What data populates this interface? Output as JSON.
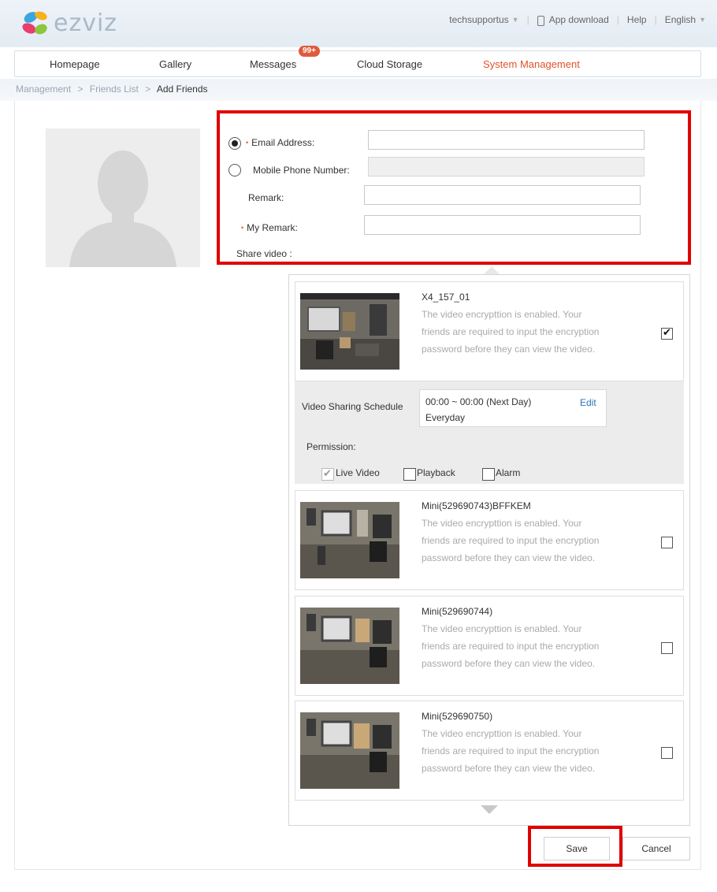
{
  "brand": {
    "name": "ezviz"
  },
  "top_links": {
    "user": "techsupportus",
    "app_download": "App download",
    "help": "Help",
    "language": "English"
  },
  "nav": {
    "items": [
      {
        "label": "Homepage"
      },
      {
        "label": "Gallery"
      },
      {
        "label": "Messages",
        "badge": "99+"
      },
      {
        "label": "Cloud Storage"
      },
      {
        "label": "System Management",
        "active": true
      }
    ]
  },
  "breadcrumb": {
    "items": [
      "Management",
      "Friends List",
      "Add Friends"
    ],
    "separator": ">"
  },
  "form": {
    "email_label": "Email Address:",
    "email_value": "",
    "phone_label": "Mobile Phone Number:",
    "phone_value": "",
    "remark_label": "Remark:",
    "remark_value": "",
    "my_remark_label": "My Remark:",
    "my_remark_value": "",
    "share_video_label": "Share video :",
    "selected_contact": "email"
  },
  "cameras": [
    {
      "name": "X4_157_01",
      "desc": "The video encrypttion is enabled. Your friends are required to input the encryption password before they can view the video.",
      "checked": true
    },
    {
      "name": "Mini(529690743)BFFKEM",
      "desc": "The video encrypttion is enabled. Your friends are required to input the encryption password before they can view the video.",
      "checked": false
    },
    {
      "name": "Mini(529690744)",
      "desc": "The video encrypttion is enabled. Your friends are required to input the encryption password before they can view the video.",
      "checked": false
    },
    {
      "name": "Mini(529690750)",
      "desc": "The video encrypttion is enabled. Your friends are required to input the encryption password before they can view the video.",
      "checked": false
    }
  ],
  "schedule": {
    "label": "Video Sharing Schedule",
    "time": "00:00 ~ 00:00 (Next Day)",
    "days": "Everyday",
    "edit_label": "Edit"
  },
  "permission": {
    "label": "Permission:",
    "options": [
      {
        "label": "Live Video",
        "checked": true
      },
      {
        "label": "Playback",
        "checked": false
      },
      {
        "label": "Alarm",
        "checked": false
      }
    ]
  },
  "actions": {
    "save": "Save",
    "cancel": "Cancel"
  },
  "colors": {
    "highlight": "#e00000",
    "active_nav": "#e0522b",
    "link": "#2a73b8",
    "badge": "#e05a3c"
  }
}
